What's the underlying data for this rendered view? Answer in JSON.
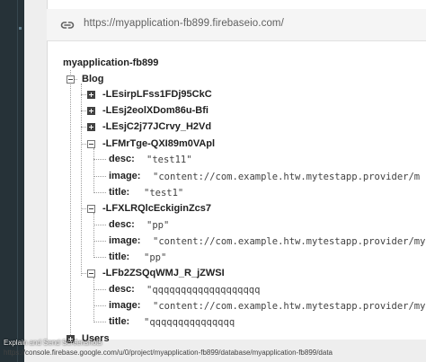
{
  "url_bar": {
    "url": "https://myapplication-fb899.firebaseio.com/",
    "icon": "link-icon"
  },
  "tree": {
    "root": "myapplication-fb899",
    "blog": {
      "label": "Blog",
      "collapsed_children": [
        "-LEsirpLFss1FDj95CkC",
        "-LEsj2eolXDom86u-Bfi",
        "-LEsjC2j77JCrvy_H2Vd"
      ],
      "posts": [
        {
          "key": "-LFMrTge-QXI89m0VApl",
          "desc": "\"test11\"",
          "image": "\"content://com.example.htw.mytestapp.provider/m",
          "title": "\"test1\""
        },
        {
          "key": "-LFXLRQlcEckiginZcs7",
          "desc": "\"pp\"",
          "image": "\"content://com.example.htw.mytestapp.provider/my",
          "title": "\"pp\""
        },
        {
          "key": "-LFb2ZSQqWMJ_R_jZWSI",
          "desc": "\"qqqqqqqqqqqqqqqqqqq",
          "image": "\"content://com.example.htw.mytestapp.provider/my",
          "title": "\"qqqqqqqqqqqqqqq"
        }
      ],
      "field_labels": {
        "desc": "desc:",
        "image": "image:",
        "title": "title:"
      }
    },
    "users": {
      "label": "Users"
    }
  },
  "status": {
    "title": "Explain and Send Screenshots",
    "url": "https://console.firebase.google.com/u/0/project/myapplication-fb899/database/myapplication-fb899/data"
  }
}
